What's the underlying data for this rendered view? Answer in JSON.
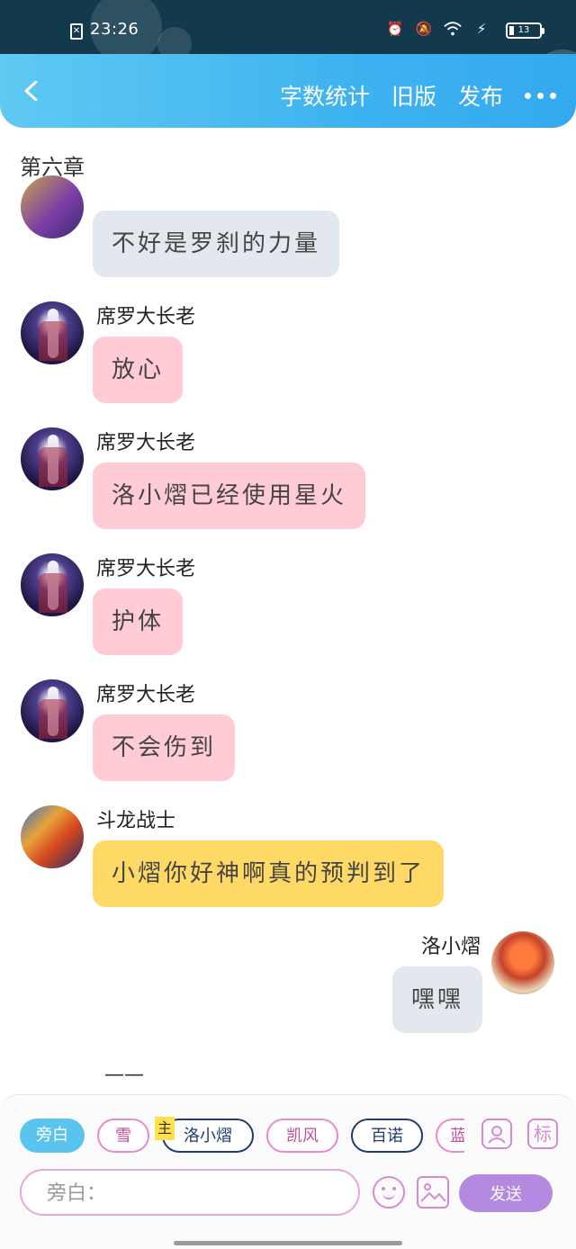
{
  "status_bar": {
    "time": "23:26",
    "battery": "13",
    "icons": [
      "sim-card-icon",
      "alarm-icon",
      "mute-icon",
      "wifi-icon",
      "charging-icon",
      "battery-icon"
    ]
  },
  "header": {
    "back_icon": "chevron-left-icon",
    "actions": [
      "字数统计",
      "旧版",
      "发布"
    ],
    "more_icon": "more-dots-icon",
    "color": "#3fb3f0"
  },
  "chapter": "第六章",
  "messages": [
    {
      "sender": "",
      "text": "不好是罗刹的力量",
      "color": "#e3e7ee",
      "side": "left"
    },
    {
      "sender": "席罗大长老",
      "text": "放心",
      "color": "#ffccd6",
      "side": "left"
    },
    {
      "sender": "席罗大长老",
      "text": "洛小熠已经使用星火",
      "color": "#ffccd6",
      "side": "left"
    },
    {
      "sender": "席罗大长老",
      "text": "护体",
      "color": "#ffccd6",
      "side": "left"
    },
    {
      "sender": "席罗大长老",
      "text": "不会伤到",
      "color": "#ffccd6",
      "side": "left"
    },
    {
      "sender": "斗龙战士",
      "text": "小熠你好神啊真的预判到了",
      "color": "#ffd966",
      "side": "left"
    },
    {
      "sender": "洛小熠",
      "text": "嘿嘿",
      "color": "#e3e7ee",
      "side": "right"
    }
  ],
  "trailing_text": "——",
  "composer": {
    "chips": [
      "旁白",
      "雪",
      "洛小熠",
      "凯风",
      "百诺",
      "蓝"
    ],
    "main_tag": "主",
    "tool_label": "标",
    "input_placeholder": "旁白：",
    "send_label": "发送",
    "accent": "#b489e0"
  }
}
